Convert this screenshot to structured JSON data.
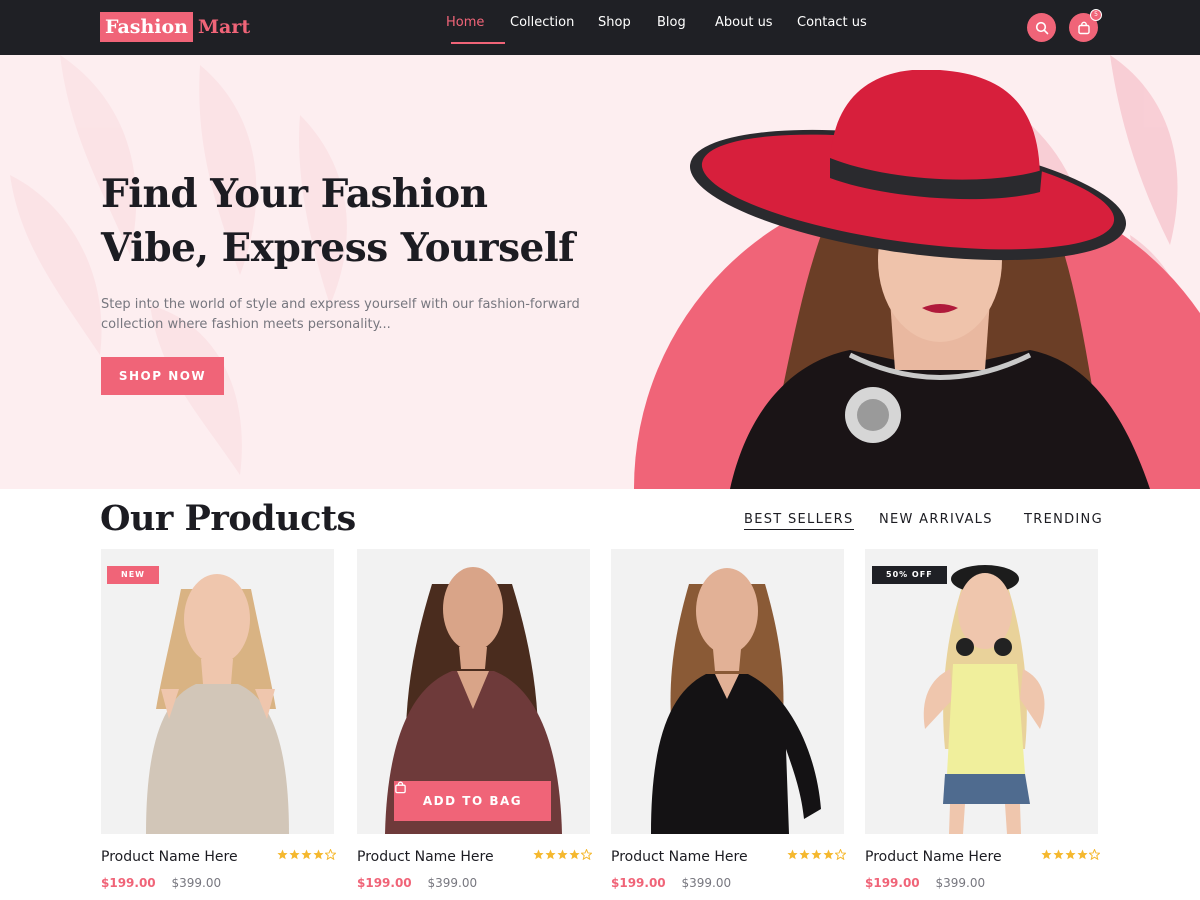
{
  "brand": {
    "part1": "Fashion",
    "part2": "Mart"
  },
  "nav": {
    "items": [
      {
        "label": "Home",
        "active": true
      },
      {
        "label": "Collection",
        "active": false
      },
      {
        "label": "Shop",
        "active": false
      },
      {
        "label": "Blog",
        "active": false
      },
      {
        "label": "About us",
        "active": false
      },
      {
        "label": "Contact us",
        "active": false
      }
    ],
    "cart_count": "5"
  },
  "hero": {
    "title_line1": "Find Your Fashion",
    "title_line2": "Vibe, Express Yourself",
    "subtitle_line1": "Step into the world of style and express yourself with our fashion-forward",
    "subtitle_line2": "collection where fashion meets personality...",
    "cta": "SHOP NOW"
  },
  "products_section": {
    "title": "Our Products",
    "filters": [
      {
        "label": "BEST SELLERS",
        "active": true
      },
      {
        "label": "NEW ARRIVALS",
        "active": false
      },
      {
        "label": "TRENDING",
        "active": false
      }
    ]
  },
  "products": [
    {
      "name": "Product Name Here",
      "price": "$199.00",
      "old_price": "$399.00",
      "rating": 4,
      "badge": "NEW"
    },
    {
      "name": "Product Name Here",
      "price": "$199.00",
      "old_price": "$399.00",
      "rating": 4,
      "add_to_bag": "ADD TO BAG"
    },
    {
      "name": "Product Name Here",
      "price": "$199.00",
      "old_price": "$399.00",
      "rating": 4
    },
    {
      "name": "Product Name Here",
      "price": "$199.00",
      "old_price": "$399.00",
      "rating": 4,
      "badge": "50% OFF"
    }
  ],
  "colors": {
    "accent": "#f06478",
    "dark": "#1f2025",
    "hero_bg": "#fdeef0",
    "star": "#f5b82e"
  },
  "icons": {
    "search": "search-icon",
    "cart": "shopping-bag-icon",
    "star": "star-icon"
  }
}
